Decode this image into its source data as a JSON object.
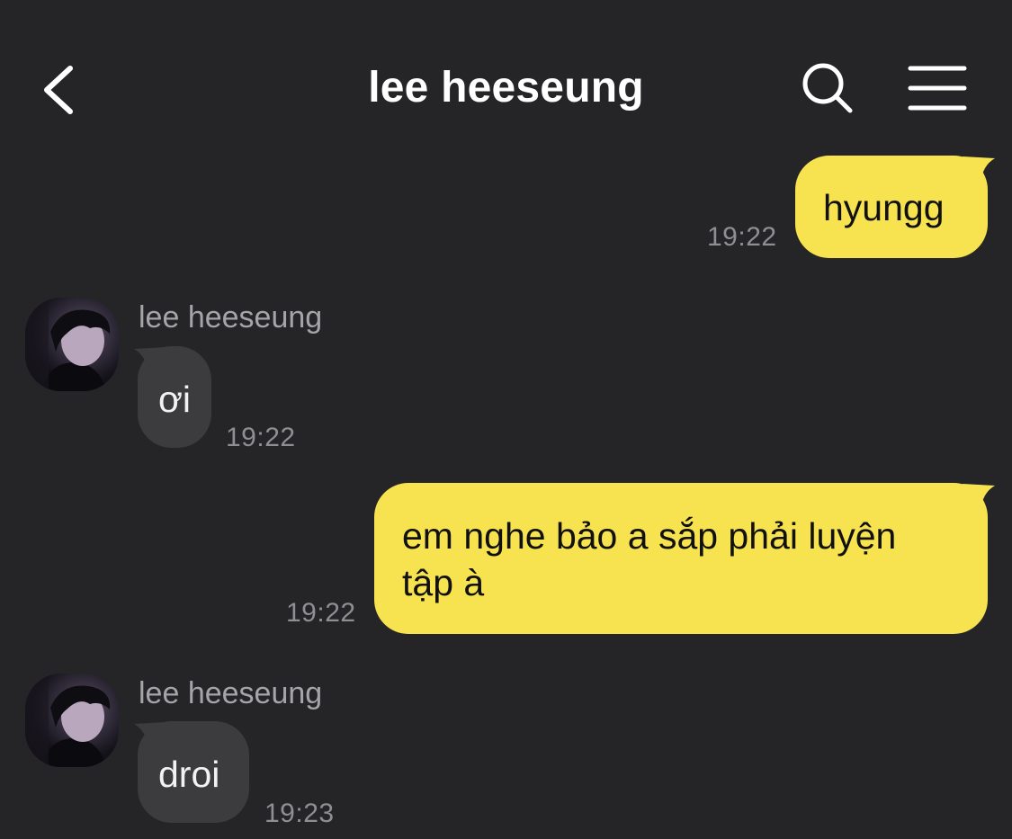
{
  "header": {
    "title": "lee heeseung",
    "back_icon": "chevron-left-icon",
    "search_icon": "search-icon",
    "menu_icon": "hamburger-menu-icon"
  },
  "colors": {
    "background": "#252527",
    "my_bubble": "#f7e24f",
    "their_bubble": "#3c3c3e",
    "timestamp": "#8f8f93"
  },
  "messages": [
    {
      "from": "me",
      "text": "hyungg",
      "time": "19:22"
    },
    {
      "from": "lee heeseung",
      "sender_label": "lee heeseung",
      "text": "ơi",
      "time": "19:22"
    },
    {
      "from": "me",
      "text_line1": "em nghe bảo a sắp phải luyện",
      "text_line2": "tập à",
      "time": "19:22"
    },
    {
      "from": "lee heeseung",
      "sender_label": "lee heeseung",
      "text": "droi",
      "time": "19:23"
    }
  ]
}
